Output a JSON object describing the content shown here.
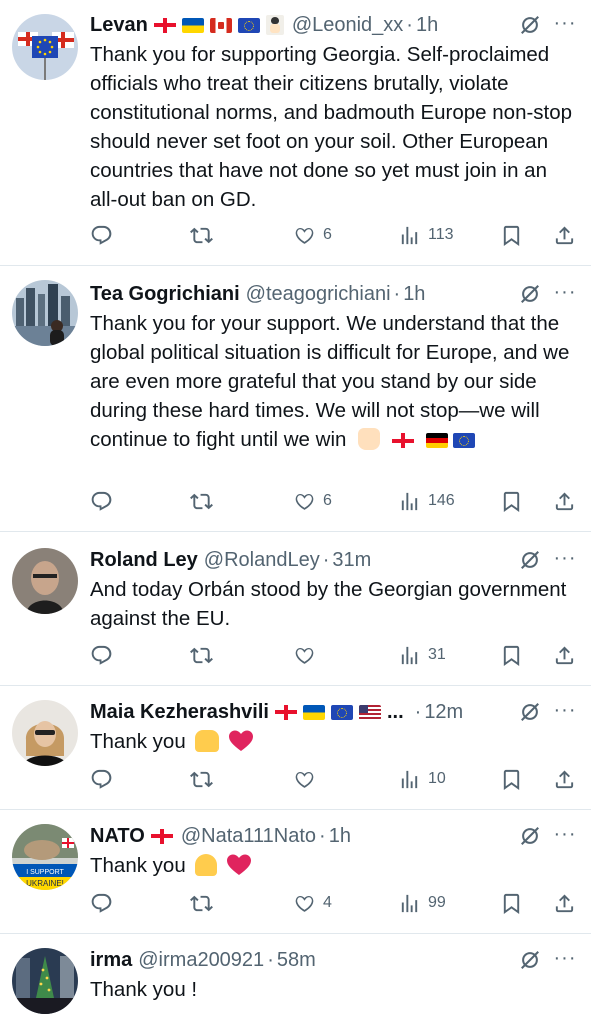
{
  "tweets": [
    {
      "name": "Levan",
      "flags": [
        "georgia-flag",
        "ukraine-flag",
        "canada-flag",
        "eu-flag",
        "person-emoji"
      ],
      "handle": "@Leonid_xx",
      "time": "1h",
      "text": "Thank you for supporting Georgia. Self-proclaimed officials who treat their citizens brutally, violate constitutional norms, and badmouth Europe non-stop should never set foot on your soil. Other European countries that have not done so yet must join in an all-out ban on GD.",
      "likes": "6",
      "views": "113"
    },
    {
      "name": "Tea Gogrichiani",
      "handle": "@teagogrichiani",
      "time": "1h",
      "text": "Thank you for your support. We understand that the global political situation is difficult for Europe, and we are even more grateful that you stand by our side during these hard times. We will not stop—we will continue to fight until we win",
      "text_emojis": [
        "raised-fist-emoji",
        "georgia-flag",
        "germany-flag",
        "eu-flag"
      ],
      "likes": "6",
      "views": "146"
    },
    {
      "name": "Roland Ley",
      "handle": "@RolandLey",
      "time": "31m",
      "text": "And today Orbán stood by the Georgian government against the EU.",
      "likes": "",
      "views": "31"
    },
    {
      "name": "Maia Kezherashvili",
      "flags": [
        "georgia-flag",
        "ukraine-flag",
        "eu-flag",
        "usa-flag"
      ],
      "flags_more": "...",
      "handle": "",
      "time": "12m",
      "text": "Thank you",
      "text_emojis": [
        "raising-hands-emoji",
        "red-heart-emoji"
      ],
      "likes": "",
      "views": "10"
    },
    {
      "name": "NATO",
      "flags": [
        "georgia-flag"
      ],
      "handle": "@Nata111Nato",
      "time": "1h",
      "text": "Thank you",
      "text_emojis": [
        "folded-hands-emoji",
        "red-heart-emoji"
      ],
      "avatar_text": [
        "I SUPPORT",
        "UKRAINE!"
      ],
      "likes": "4",
      "views": "99"
    },
    {
      "name": "irma",
      "handle": "@irma200921",
      "time": "58m",
      "text": "Thank you !"
    }
  ],
  "dot_sep": "·",
  "more_glyph": "···",
  "colors": {
    "text": "#0f1419",
    "secondary": "#536471",
    "divider": "#e1e8ed",
    "heart_red": "#e0245e"
  }
}
